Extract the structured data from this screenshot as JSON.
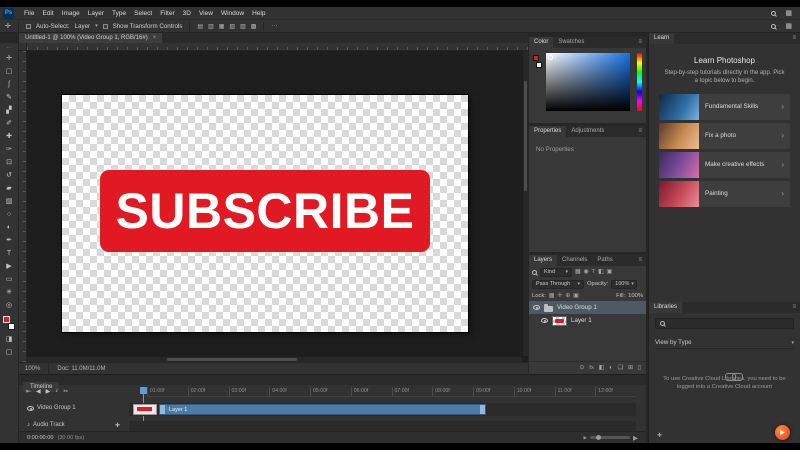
{
  "ui": {
    "caret": "▾",
    "chevron": "›",
    "close": "×",
    "panel_menu": "≡",
    "dots": "···",
    "plus": "✚",
    "play_glyph": "▶",
    "workspace_icon": "▦"
  },
  "colors": {
    "accent_red": "#e01922",
    "clip_blue": "#4c7ba6",
    "ps_logo_blue": "#31a8ff",
    "selected_layer": "#4d5a66"
  },
  "menu": {
    "logo": "Ps",
    "items": [
      "File",
      "Edit",
      "Image",
      "Layer",
      "Type",
      "Select",
      "Filter",
      "3D",
      "View",
      "Window",
      "Help"
    ]
  },
  "options": {
    "auto_select_label": "Auto-Select:",
    "auto_select_value": "Layer",
    "show_transform_label": "Show Transform Controls",
    "align_icons": [
      "▤",
      "▥",
      "▦",
      "▧",
      "▨",
      "▩"
    ]
  },
  "doc_tab": {
    "title": "Untitled-1 @ 100% (Video Group 1, RGB/16#)"
  },
  "toolbar": {
    "expander": "···",
    "tools": [
      {
        "name": "move",
        "glyph": "✛"
      },
      {
        "name": "marquee",
        "glyph": "▢"
      },
      {
        "name": "lasso",
        "glyph": "ʃ"
      },
      {
        "name": "quick-selection",
        "glyph": "✎"
      },
      {
        "name": "crop",
        "glyph": "▞"
      },
      {
        "name": "eyedropper",
        "glyph": "✐"
      },
      {
        "name": "healing-brush",
        "glyph": "✚"
      },
      {
        "name": "brush",
        "glyph": "✑"
      },
      {
        "name": "clone-stamp",
        "glyph": "⊡"
      },
      {
        "name": "history-brush",
        "glyph": "↺"
      },
      {
        "name": "eraser",
        "glyph": "▰"
      },
      {
        "name": "gradient",
        "glyph": "▨"
      },
      {
        "name": "blur",
        "glyph": "○"
      },
      {
        "name": "dodge",
        "glyph": "◐"
      },
      {
        "name": "pen",
        "glyph": "✒"
      },
      {
        "name": "type",
        "glyph": "T"
      },
      {
        "name": "path-selection",
        "glyph": "▶"
      },
      {
        "name": "shape",
        "glyph": "▭"
      },
      {
        "name": "hand",
        "glyph": "✳"
      },
      {
        "name": "zoom",
        "glyph": "◎"
      }
    ],
    "mask_icon": "◨",
    "screen_icon": "▢"
  },
  "canvas": {
    "button_label": "SUBSCRIBE"
  },
  "status": {
    "zoom": "100%",
    "doc": "Doc: 11.0M/11.0M"
  },
  "color_panel": {
    "tabs": [
      "Color",
      "Swatches"
    ]
  },
  "properties_panel": {
    "tabs": [
      "Properties",
      "Adjustments"
    ],
    "empty_text": "No Properties"
  },
  "layers_panel": {
    "tabs": [
      "Layers",
      "Channels",
      "Paths"
    ],
    "kind_value": "Kind",
    "filter_icons": [
      "▦",
      "◉",
      "T",
      "◧",
      "▣"
    ],
    "blend_value": "Pass Through",
    "opacity_label": "Opacity:",
    "opacity_value": "100%",
    "lock_label": "Lock:",
    "lock_icons": [
      "▦",
      "✛",
      "⊕",
      "▣"
    ],
    "fill_label": "Fill:",
    "fill_value": "100%",
    "rows": [
      {
        "name": "Video Group 1"
      },
      {
        "name": "Layer 1"
      }
    ],
    "bottom_icons": [
      "⊙",
      "fx",
      "◧",
      "◐",
      "❏",
      "⊞",
      "▯"
    ]
  },
  "learn_panel": {
    "tab": "Learn",
    "title": "Learn Photoshop",
    "subtitle": "Step-by-step tutorials directly in the app. Pick a topic below to begin.",
    "items": [
      {
        "label": "Fundamental Skills"
      },
      {
        "label": "Fix a photo"
      },
      {
        "label": "Make creative effects"
      },
      {
        "label": "Painting"
      }
    ]
  },
  "libraries_panel": {
    "tab": "Libraries",
    "view_by_label": "View by Type",
    "message": "To use Creative Cloud Libraries, you need to be logged into a Creative Cloud account"
  },
  "timeline": {
    "tab": "Timeline",
    "transport_icons": [
      "⇤",
      "◀",
      "▶",
      "♪",
      "✂"
    ],
    "ruler_labels": [
      "01:00f",
      "02:00f",
      "03:00f",
      "04:00f",
      "05:00f",
      "06:00f",
      "07:00f",
      "08:00f",
      "09:00f",
      "10:00f",
      "11:00f",
      "12:00f"
    ],
    "video_track_label": "Video Group 1",
    "clip_label": "Layer 1",
    "audio_track_label": "Audio Track",
    "timecode": "0:00:00:00",
    "fps": "(30.00 fps)"
  }
}
